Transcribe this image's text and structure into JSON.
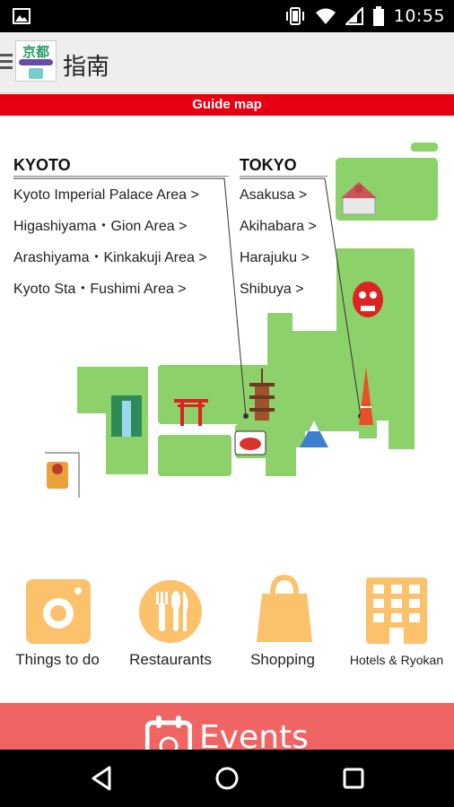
{
  "status_bar": {
    "time": "10:55",
    "icons": [
      "gallery-icon",
      "vibrate-icon",
      "wifi-icon",
      "signal-icon",
      "battery-icon"
    ]
  },
  "app_bar": {
    "logo_text": "京都",
    "title": "指南"
  },
  "banner": {
    "label": "Guide map"
  },
  "kyoto": {
    "heading": "KYOTO",
    "links": [
      "Kyoto Imperial Palace Area >",
      "Higashiyama・Gion Area >",
      "Arashiyama・Kinkakuji Area >",
      "Kyoto Sta・Fushimi Area >"
    ]
  },
  "tokyo": {
    "heading": "TOKYO",
    "links": [
      "Asakusa >",
      "Akihabara >",
      "Harajuku >",
      "Shibuya >"
    ]
  },
  "categories": [
    {
      "label": "Things to do",
      "icon": "camera-icon"
    },
    {
      "label": "Restaurants",
      "icon": "cutlery-icon"
    },
    {
      "label": "Shopping",
      "icon": "shopping-bag-icon"
    },
    {
      "label": "Hotels & Ryokan",
      "icon": "hotel-building-icon"
    }
  ],
  "events": {
    "label": "Events"
  },
  "colors": {
    "accent_red": "#e60012",
    "map_green": "#8dd16a",
    "category_orange": "#fbc26b",
    "events_bg": "#f06464"
  }
}
